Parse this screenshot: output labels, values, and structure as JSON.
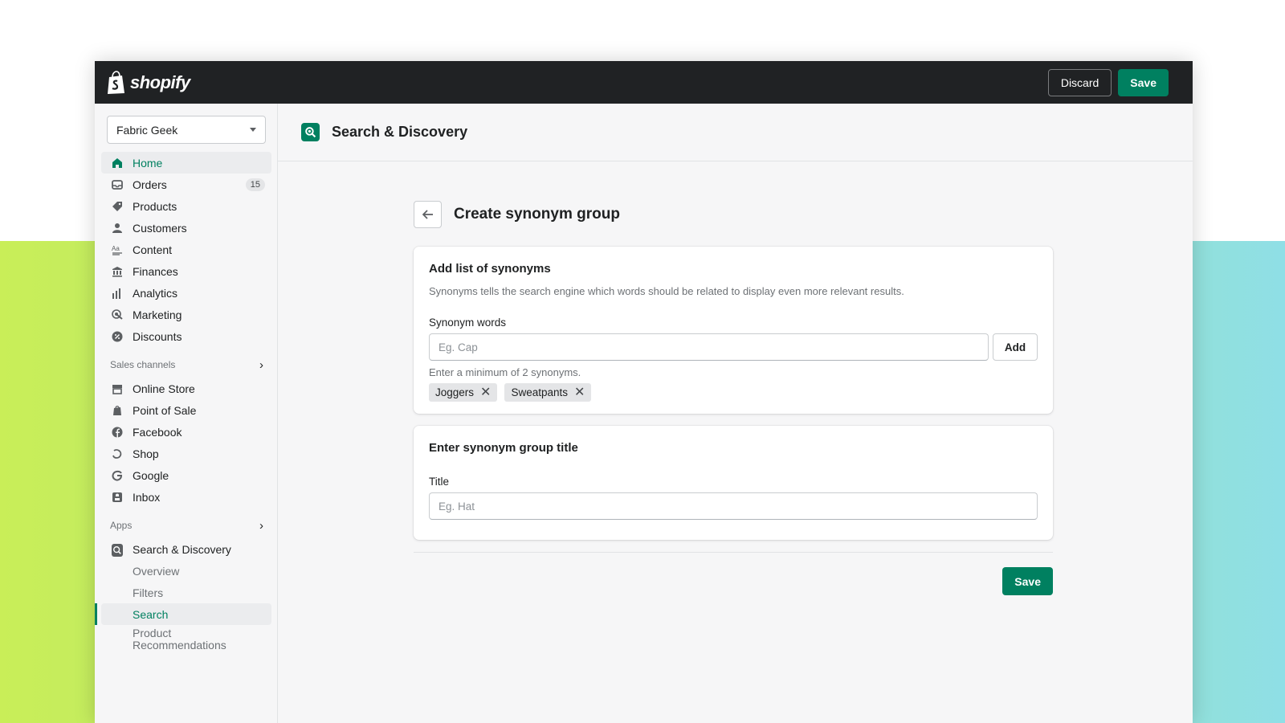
{
  "topbar": {
    "brand": "shopify",
    "discard_label": "Discard",
    "save_label": "Save"
  },
  "sidebar": {
    "store_name": "Fabric Geek",
    "main_items": [
      {
        "label": "Home",
        "icon": "home-icon"
      },
      {
        "label": "Orders",
        "icon": "inbox-tray-icon",
        "badge": "15"
      },
      {
        "label": "Products",
        "icon": "tag-icon"
      },
      {
        "label": "Customers",
        "icon": "person-icon"
      },
      {
        "label": "Content",
        "icon": "text-icon"
      },
      {
        "label": "Finances",
        "icon": "bank-icon"
      },
      {
        "label": "Analytics",
        "icon": "bar-chart-icon"
      },
      {
        "label": "Marketing",
        "icon": "target-icon"
      },
      {
        "label": "Discounts",
        "icon": "discount-icon"
      }
    ],
    "sales_channels_heading": "Sales channels",
    "sales_channels": [
      {
        "label": "Online Store",
        "icon": "store-icon"
      },
      {
        "label": "Point of Sale",
        "icon": "bag-icon"
      },
      {
        "label": "Facebook",
        "icon": "facebook-icon"
      },
      {
        "label": "Shop",
        "icon": "shop-icon"
      },
      {
        "label": "Google",
        "icon": "google-icon"
      },
      {
        "label": "Inbox",
        "icon": "inbox-icon"
      }
    ],
    "apps_heading": "Apps",
    "app": {
      "label": "Search & Discovery",
      "icon": "search-discovery-icon"
    },
    "app_subitems": [
      "Overview",
      "Filters",
      "Search",
      "Product\nRecommendations"
    ]
  },
  "main": {
    "header_title": "Search & Discovery",
    "page_title": "Create synonym group",
    "card1": {
      "title": "Add list of synonyms",
      "description": "Synonyms tells the search engine which words should be related to display even more relevant results.",
      "field_label": "Synonym words",
      "placeholder": "Eg. Cap",
      "add_label": "Add",
      "help": "Enter a minimum of 2 synonyms.",
      "tags": [
        "Joggers",
        "Sweatpants"
      ]
    },
    "card2": {
      "title": "Enter synonym group title",
      "field_label": "Title",
      "placeholder": "Eg. Hat"
    },
    "save_label": "Save"
  },
  "colors": {
    "accent": "#008060",
    "topbar": "#202224"
  }
}
